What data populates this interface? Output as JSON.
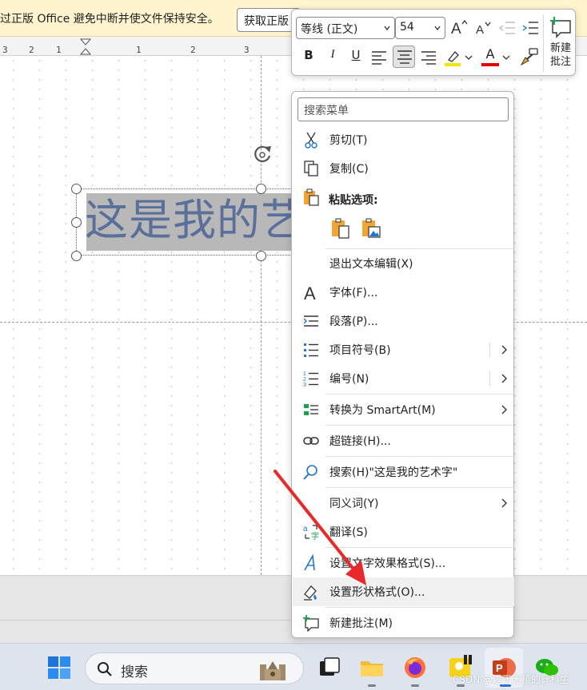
{
  "notification": {
    "message": "过正版 Office 避免中断并使文件保持安全。",
    "button_label": "获取正版"
  },
  "ruler": {
    "ticks": [
      "3",
      "2",
      "1",
      "1",
      "2",
      "3"
    ]
  },
  "slide": {
    "text": "这是我的艺术字"
  },
  "mini_toolbar": {
    "font_name": "等线 (正文)",
    "font_size": "54",
    "bold": "B",
    "italic": "I",
    "underline": "U",
    "font_color_letter": "A",
    "highlight_color": "#f5e400",
    "font_color": "#e00000",
    "new_comment_label_line1": "新建",
    "new_comment_label_line2": "批注"
  },
  "context_menu": {
    "search_placeholder": "搜索菜单",
    "paste_options_label": "粘贴选项:",
    "items": [
      {
        "label": "剪切(T)",
        "icon": "scissors-icon"
      },
      {
        "label": "复制(C)",
        "icon": "copy-icon"
      },
      {
        "label": "退出文本编辑(X)",
        "icon": ""
      },
      {
        "label": "字体(F)...",
        "icon": "font-icon"
      },
      {
        "label": "段落(P)...",
        "icon": "paragraph-icon"
      },
      {
        "label": "项目符号(B)",
        "icon": "bullets-icon",
        "submenu": true
      },
      {
        "label": "编号(N)",
        "icon": "numbering-icon",
        "submenu": true
      },
      {
        "label": "转换为 SmartArt(M)",
        "icon": "smartart-icon",
        "submenu": true
      },
      {
        "label": "超链接(H)...",
        "icon": "link-icon"
      },
      {
        "label": "搜索(H)\"这是我的艺术字\"",
        "icon": "search-icon"
      },
      {
        "label": "同义词(Y)",
        "icon": "",
        "submenu": true
      },
      {
        "label": "翻译(S)",
        "icon": "translate-icon"
      },
      {
        "label": "设置文字效果格式(S)...",
        "icon": "text-effect-icon"
      },
      {
        "label": "设置形状格式(O)...",
        "icon": "shape-format-icon"
      },
      {
        "label": "新建批注(M)",
        "icon": "new-comment-icon"
      }
    ]
  },
  "taskbar": {
    "search_label": "搜索"
  },
  "watermark": "CSDN @过于无顶的计科生",
  "colors": {
    "accent_arrow": "#e8282a",
    "text_fill": "#5a6f9a"
  }
}
